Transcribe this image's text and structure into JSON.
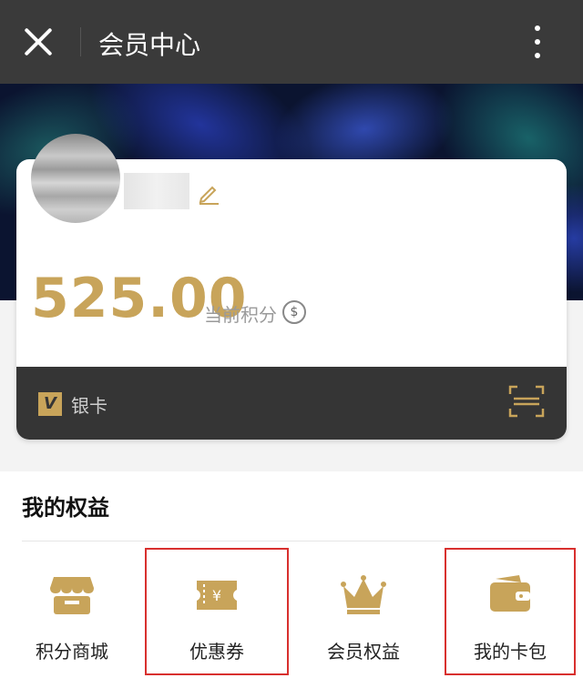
{
  "header": {
    "title": "会员中心"
  },
  "card": {
    "points": "525.00",
    "points_label": "当前积分",
    "tier": "银卡",
    "tier_badge": "V"
  },
  "benefits": {
    "title": "我的权益",
    "items": [
      {
        "label": "积分商城",
        "icon": "store-icon"
      },
      {
        "label": "优惠券",
        "icon": "coupon-icon"
      },
      {
        "label": "会员权益",
        "icon": "crown-icon"
      },
      {
        "label": "我的卡包",
        "icon": "wallet-icon"
      }
    ]
  },
  "colors": {
    "gold": "#c8a45a",
    "dark": "#353535",
    "highlight": "#d8302e"
  }
}
